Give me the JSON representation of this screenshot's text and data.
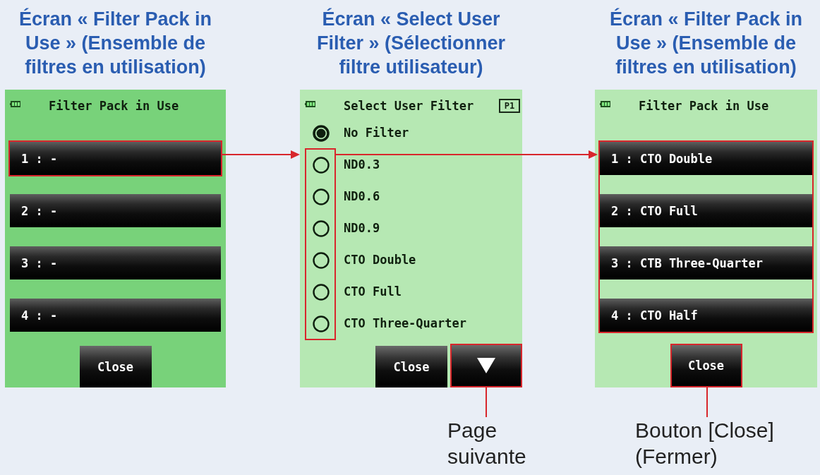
{
  "screens": [
    {
      "caption": "Écran « Filter Pack in Use » (Ensemble de filtres en utilisation)",
      "kind": "pack",
      "color": "#78d27a",
      "title": "Filter Pack in Use",
      "slots": [
        {
          "label": "1 : -",
          "highlighted": true
        },
        {
          "label": "2 : -",
          "highlighted": false
        },
        {
          "label": "3 : -",
          "highlighted": false
        },
        {
          "label": "4 : -",
          "highlighted": false
        }
      ],
      "close_button": {
        "label": "Close",
        "highlighted": false
      }
    },
    {
      "caption": "Écran « Select User Filter » (Sélectionner filtre utilisateur)",
      "kind": "select",
      "color": "#b6e8b3",
      "title": "Select User Filter",
      "page_badge": "P1",
      "options": [
        {
          "label": "No Filter",
          "selected": true
        },
        {
          "label": "ND0.3",
          "selected": false
        },
        {
          "label": "ND0.6",
          "selected": false
        },
        {
          "label": "ND0.9",
          "selected": false
        },
        {
          "label": "CTO Double",
          "selected": false
        },
        {
          "label": "CTO Full",
          "selected": false
        },
        {
          "label": "CTO Three-Quarter",
          "selected": false
        }
      ],
      "close_button": {
        "label": "Close",
        "highlighted": false
      },
      "next_button": {
        "highlighted": true
      },
      "callout": "Page suivante"
    },
    {
      "caption": "Écran « Filter Pack in Use » (Ensemble de filtres en utilisation)",
      "kind": "pack",
      "color": "#b6e8b3",
      "title": "Filter Pack in Use",
      "slots": [
        {
          "label": "1 : CTO Double",
          "highlighted": true
        },
        {
          "label": "2 : CTO Full",
          "highlighted": true
        },
        {
          "label": "3 : CTB Three-Quarter",
          "highlighted": true
        },
        {
          "label": "4 : CTO Half",
          "highlighted": true
        }
      ],
      "close_button": {
        "label": "Close",
        "highlighted": true
      },
      "callout": "Bouton [Close] (Fermer)"
    }
  ]
}
